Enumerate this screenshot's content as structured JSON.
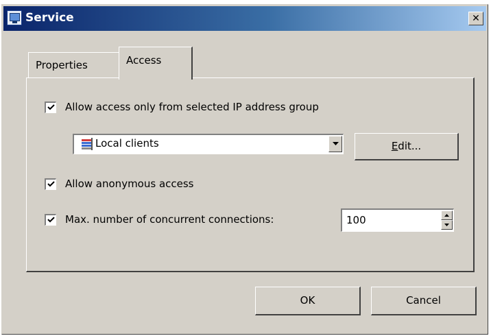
{
  "window": {
    "title": "Service",
    "close_glyph": "✕"
  },
  "tabs": [
    {
      "label": "Properties",
      "selected": false
    },
    {
      "label": "Access",
      "selected": true
    }
  ],
  "access": {
    "ip_group_checkbox": {
      "label": "Allow access only from selected IP address group",
      "checked": true
    },
    "ip_group_select": {
      "value": "Local clients",
      "icon": "network-group-icon"
    },
    "edit_button": {
      "mnemonic": "E",
      "rest": "dit..."
    },
    "anonymous_checkbox": {
      "label": "Allow anonymous access",
      "checked": true
    },
    "max_connections_checkbox": {
      "label": "Max. number of concurrent connections:",
      "checked": true
    },
    "max_connections_value": "100"
  },
  "footer": {
    "ok_label": "OK",
    "cancel_label": "Cancel"
  },
  "colors": {
    "titlebar_start": "#0a246a",
    "titlebar_end": "#a6caf0",
    "face": "#d4d0c8"
  }
}
